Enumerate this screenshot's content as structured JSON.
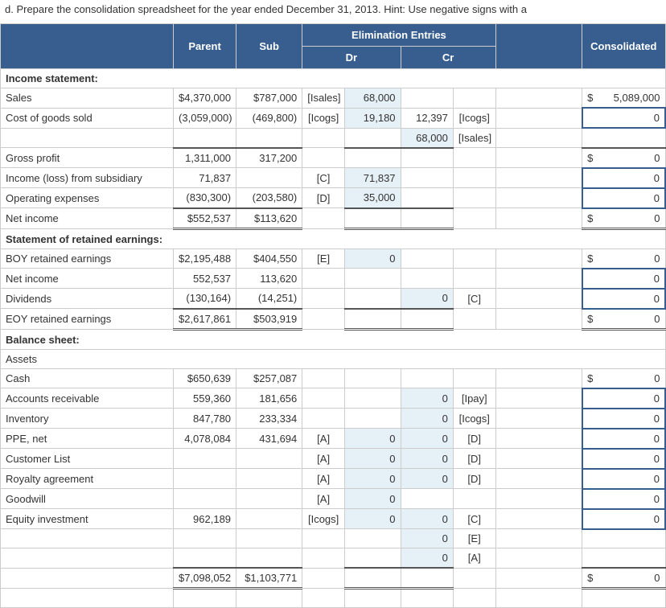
{
  "prompt": "d. Prepare the consolidation spreadsheet for the year ended December 31, 2013. Hint: Use negative signs with a",
  "headers": {
    "parent": "Parent",
    "sub": "Sub",
    "elim": "Elimination Entries",
    "dr": "Dr",
    "cr": "Cr",
    "consolidated": "Consolidated"
  },
  "sections": {
    "income": "Income statement:",
    "retained": "Statement of retained earnings:",
    "balance": "Balance sheet:"
  },
  "rows": {
    "sales": {
      "label": "Sales",
      "parent": "$4,370,000",
      "sub": "$787,000",
      "drlab": "[Isales]",
      "dramt": "68,000",
      "cramt": "",
      "crlab": "",
      "csym": "$",
      "cons": "5,089,000"
    },
    "cogs": {
      "label": "Cost of goods sold",
      "parent": "(3,059,000)",
      "sub": "(469,800)",
      "drlab": "[Icogs]",
      "dramt": "19,180",
      "cramt": "12,397",
      "crlab": "[Icogs]",
      "csym": "",
      "cons": "0"
    },
    "cogs2": {
      "label": "",
      "parent": "",
      "sub": "",
      "drlab": "",
      "dramt": "",
      "cramt": "68,000",
      "crlab": "[Isales]",
      "csym": "",
      "cons": ""
    },
    "gross": {
      "label": "Gross profit",
      "parent": "1,311,000",
      "sub": "317,200",
      "csym": "$",
      "cons": "0"
    },
    "incsub": {
      "label": "Income (loss) from subsidiary",
      "parent": "71,837",
      "sub": "",
      "drlab": "[C]",
      "dramt": "71,837",
      "cramt": "",
      "crlab": "",
      "csym": "",
      "cons": "0"
    },
    "opex": {
      "label": "Operating expenses",
      "parent": "(830,300)",
      "sub": "(203,580)",
      "drlab": "[D]",
      "dramt": "35,000",
      "cramt": "",
      "crlab": "",
      "csym": "",
      "cons": "0"
    },
    "ni": {
      "label": "Net income",
      "parent": "$552,537",
      "sub": "$113,620",
      "csym": "$",
      "cons": "0"
    },
    "boyre": {
      "label": "BOY retained earnings",
      "parent": "$2,195,488",
      "sub": "$404,550",
      "drlab": "[E]",
      "dramt": "0",
      "cramt": "",
      "crlab": "",
      "csym": "$",
      "cons": "0"
    },
    "ni2": {
      "label": "Net income",
      "parent": "552,537",
      "sub": "113,620",
      "csym": "",
      "cons": "0"
    },
    "div": {
      "label": "Dividends",
      "parent": "(130,164)",
      "sub": "(14,251)",
      "drlab": "",
      "dramt": "",
      "cramt": "0",
      "crlab": "[C]",
      "csym": "",
      "cons": "0"
    },
    "eoyre": {
      "label": "EOY retained earnings",
      "parent": "$2,617,861",
      "sub": "$503,919",
      "csym": "$",
      "cons": "0"
    },
    "assets": {
      "label": "Assets"
    },
    "cash": {
      "label": "Cash",
      "parent": "$650,639",
      "sub": "$257,087",
      "csym": "$",
      "cons": "0"
    },
    "ar": {
      "label": "Accounts receivable",
      "parent": "559,360",
      "sub": "181,656",
      "cramt": "0",
      "crlab": "[Ipay]",
      "csym": "",
      "cons": "0"
    },
    "inv": {
      "label": "Inventory",
      "parent": "847,780",
      "sub": "233,334",
      "cramt": "0",
      "crlab": "[Icogs]",
      "csym": "",
      "cons": "0"
    },
    "ppe": {
      "label": "PPE, net",
      "parent": "4,078,084",
      "sub": "431,694",
      "drlab": "[A]",
      "dramt": "0",
      "cramt": "0",
      "crlab": "[D]",
      "csym": "",
      "cons": "0"
    },
    "cust": {
      "label": "Customer List",
      "parent": "",
      "sub": "",
      "drlab": "[A]",
      "dramt": "0",
      "cramt": "0",
      "crlab": "[D]",
      "csym": "",
      "cons": "0"
    },
    "roy": {
      "label": "Royalty agreement",
      "parent": "",
      "sub": "",
      "drlab": "[A]",
      "dramt": "0",
      "cramt": "0",
      "crlab": "[D]",
      "csym": "",
      "cons": "0"
    },
    "gw": {
      "label": "Goodwill",
      "parent": "",
      "sub": "",
      "drlab": "[A]",
      "dramt": "0",
      "cramt": "",
      "crlab": "",
      "csym": "",
      "cons": "0"
    },
    "ei": {
      "label": "Equity investment",
      "parent": "962,189",
      "sub": "",
      "drlab": "[Icogs]",
      "dramt": "0",
      "cramt": "0",
      "crlab": "[C]",
      "csym": "",
      "cons": "0"
    },
    "ei2": {
      "label": "",
      "cramt": "0",
      "crlab": "[E]"
    },
    "ei3": {
      "label": "",
      "cramt": "0",
      "crlab": "[A]"
    },
    "totassets": {
      "label": "",
      "parent": "$7,098,052",
      "sub": "$1,103,771",
      "csym": "$",
      "cons": "0"
    }
  }
}
